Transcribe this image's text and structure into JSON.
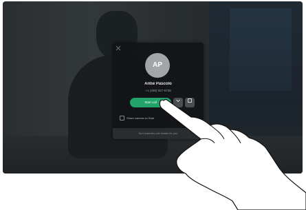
{
  "incoming_call": {
    "avatar_initials": "AP",
    "caller_name": "Antie Pascolo",
    "caller_number": "+1 (408) 527-5728",
    "answer_label": "Start call",
    "secondary_icon": "chevron-down-icon",
    "option_label": "Share camera on Start",
    "footer_label": "Sort matches call details for you"
  },
  "colors": {
    "answer_green": "#21a36a",
    "card_background": "#121416",
    "avatar_gray": "#a3a6a8"
  }
}
